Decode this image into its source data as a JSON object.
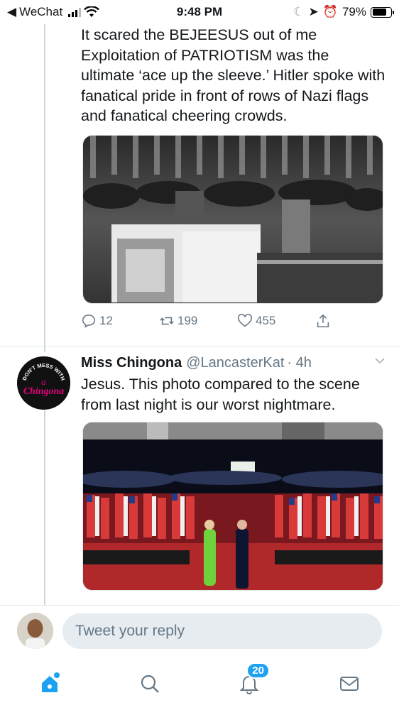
{
  "status_bar": {
    "back_app": "WeChat",
    "time": "9:48 PM",
    "battery": "79%",
    "battery_level": 0.79
  },
  "tweet1": {
    "text": "It scared the BEJEESUS out of me\n Exploitation of PATRIOTISM was the ultimate ‘ace up the sleeve.’  Hitler spoke with fanatical pride in front of rows of Nazi flags and fanatical cheering crowds.",
    "replies": "12",
    "retweets": "199",
    "likes": "455"
  },
  "tweet2": {
    "name": "Miss Chingona",
    "handle": "@LancasterKat",
    "time": "· 4h",
    "text": "Jesus. This photo compared to the scene from last night is our worst nightmare.",
    "avatar_text_top": "DON'T MESS WITH",
    "avatar_text_a": "a",
    "avatar_text_name": "Chingona"
  },
  "reply": {
    "placeholder": "Tweet your reply"
  },
  "tabbar": {
    "notifications_badge": "20"
  },
  "colors": {
    "accent": "#1da1f2",
    "muted": "#657786",
    "chingona_pink": "#e4007c"
  }
}
